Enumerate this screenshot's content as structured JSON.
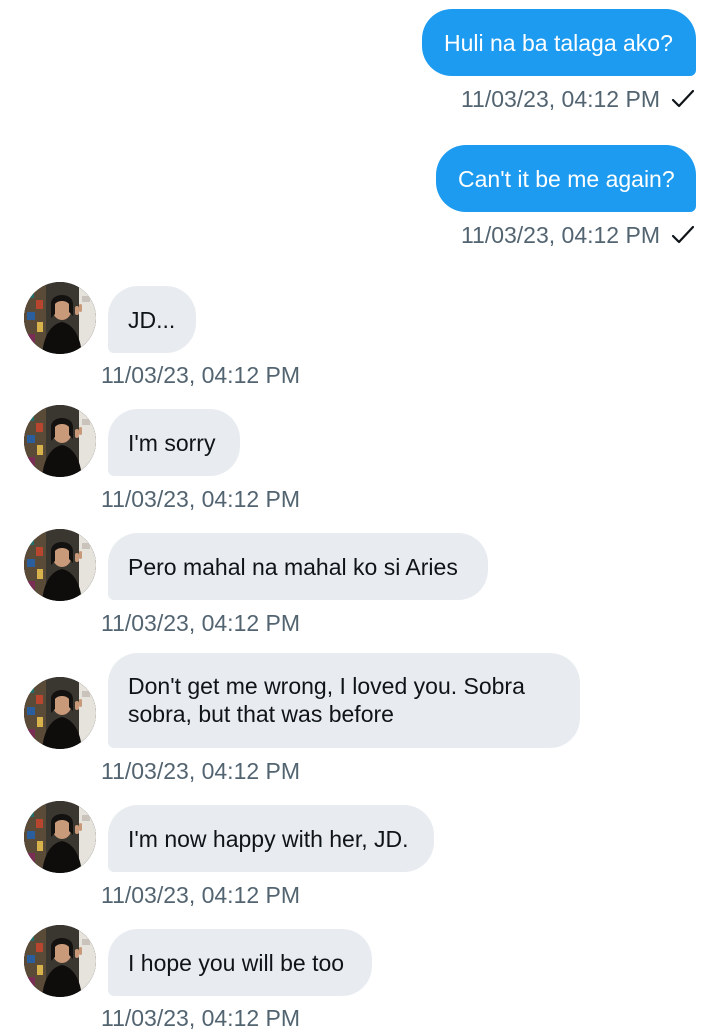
{
  "conversation": {
    "outgoing": [
      {
        "text": "Huli na ba talaga ako?",
        "time": "11/03/23, 04:12 PM",
        "status_icon": "check-icon"
      },
      {
        "text": "Can't it be me again?",
        "time": "11/03/23, 04:12 PM",
        "status_icon": "check-icon"
      }
    ],
    "incoming": [
      {
        "text": "JD...",
        "time": "11/03/23, 04:12 PM"
      },
      {
        "text": "I'm sorry",
        "time": "11/03/23, 04:12 PM"
      },
      {
        "text": "Pero mahal na mahal ko si Aries",
        "time": "11/03/23, 04:12 PM"
      },
      {
        "text": "Don't get me wrong, I loved you. Sobra sobra, but that was before",
        "time": "11/03/23, 04:12 PM"
      },
      {
        "text": "I'm now happy with her, JD.",
        "time": "11/03/23, 04:12 PM"
      },
      {
        "text": "I hope you will be too",
        "time": "11/03/23, 04:12 PM"
      }
    ]
  },
  "colors": {
    "outgoing_bubble": "#1d9bf0",
    "incoming_bubble": "#e8ecf0",
    "timestamp": "#536471",
    "text_dark": "#0f1419"
  }
}
